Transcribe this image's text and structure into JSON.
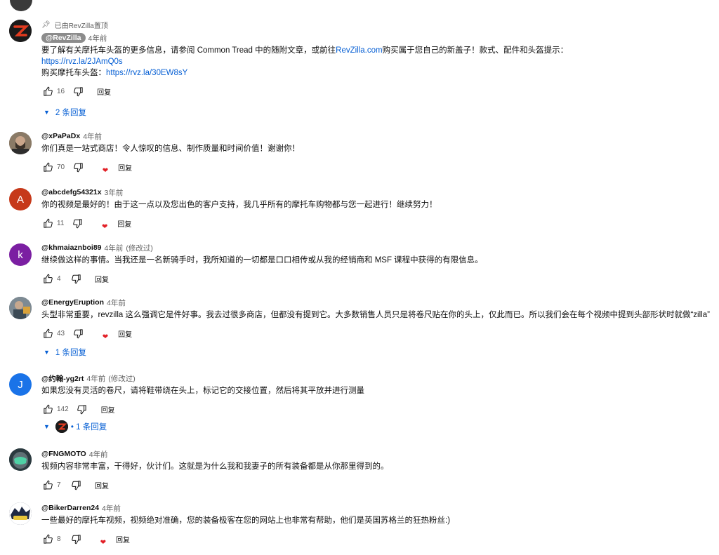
{
  "comments": [
    {
      "pinned_label": "已由RevZilla置顶",
      "author": "@RevZilla",
      "time": "4年前",
      "text_line1_before": "要了解有关摩托车头盔的更多信息，请参阅 Common Tread 中的随附文章，或前往",
      "text_line1_link": "RevZilla.com",
      "text_line1_after": "购买属于您自己的新盖子！款式、配件和头盔提示：",
      "link1": "https://rvz.la/2JAmQ0s",
      "line3_prefix": "购买摩托车头盔：",
      "link2": "https://rvz.la/30EW8sY",
      "likes": "16",
      "reply": "回复",
      "replies": "2 条回复"
    },
    {
      "author": "@xPaPaDx",
      "time": "4年前",
      "text": "你们真是一站式商店！令人惊叹的信息、制作质量和时间价值！谢谢你！",
      "likes": "70",
      "reply": "回复"
    },
    {
      "author": "@abcdefg54321x",
      "time": "3年前",
      "avatar_letter": "A",
      "text": "你的视频是最好的！由于这一点以及您出色的客户支持，我几乎所有的摩托车购物都与您一起进行！继续努力！",
      "likes": "11",
      "reply": "回复"
    },
    {
      "author": "@khmaiaznboi89",
      "time": "4年前",
      "edited": "(修改过)",
      "avatar_letter": "k",
      "text": "继续做这样的事情。当我还是一名新骑手时，我所知道的一切都是口口相传或从我的经销商和 MSF 课程中获得的有限信息。",
      "likes": "4",
      "reply": "回复"
    },
    {
      "author": "@EnergyEruption",
      "time": "4年前",
      "text": "头型非常重要，revzilla 这么强调它是件好事。我去过很多商店，但都没有提到它。大多数销售人员只是将卷尺贴在你的头上，仅此而已。所以我们会在每个视频中提到头部形状时就做“zilla”",
      "likes": "43",
      "reply": "回复",
      "replies": "1 条回复"
    },
    {
      "author": "@约翰-yg2rt",
      "time": "4年前",
      "edited": "(修改过)",
      "avatar_letter": "J",
      "text": "如果您没有灵活的卷尺，请将鞋带绕在头上，标记它的交接位置，然后将其平放并进行测量",
      "likes": "142",
      "reply": "回复",
      "replies": "• 1 条回复"
    },
    {
      "author": "@FNGMOTO",
      "time": "4年前",
      "text": "视频内容非常丰富，干得好，伙计们。这就是为什么我和我妻子的所有装备都是从你那里得到的。",
      "likes": "7",
      "reply": "回复"
    },
    {
      "author": "@BikerDarren24",
      "time": "4年前",
      "text": "一些最好的摩托车视频，视频绝对准确，您的装备极客在您的网站上也非常有帮助，他们是英国苏格兰的狂热粉丝:)",
      "likes": "8",
      "reply": "回复"
    }
  ],
  "colors": {
    "link": "#065fd4",
    "heart": "#e21f26",
    "avatar_a": "#c6391a",
    "avatar_k": "#7b1fa2",
    "avatar_j": "#1a73e8"
  },
  "icons": [
    "thumb-up-icon",
    "thumb-down-icon",
    "pin-icon",
    "caret-down-icon",
    "heart-icon"
  ]
}
